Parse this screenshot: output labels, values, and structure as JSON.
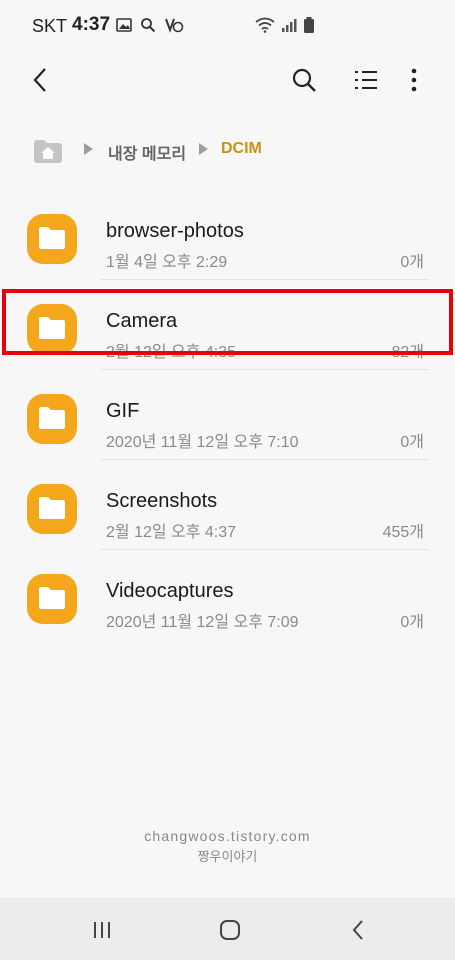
{
  "status_bar": {
    "carrier": "SKT",
    "time": "4:37"
  },
  "icons": {
    "back": "back-arrow-icon",
    "search": "search-icon",
    "list_view": "list-view-icon",
    "more": "more-vert-icon",
    "home": "home-icon",
    "folder": "folder-icon"
  },
  "breadcrumb": {
    "items": [
      "내장 메모리",
      "DCIM"
    ]
  },
  "folders": [
    {
      "name": "browser-photos",
      "date": "1월 4일 오후 2:29",
      "count": "0개"
    },
    {
      "name": "Camera",
      "date": "2월 12일 오후 4:35",
      "count": "82개"
    },
    {
      "name": "GIF",
      "date": "2020년 11월 12일 오후 7:10",
      "count": "0개"
    },
    {
      "name": "Screenshots",
      "date": "2월 12일 오후 4:37",
      "count": "455개"
    },
    {
      "name": "Videocaptures",
      "date": "2020년 11월 12일 오후 7:09",
      "count": "0개"
    }
  ],
  "watermark": {
    "line1": "changwoos.tistory.com",
    "line2": "짱우이야기"
  },
  "colors": {
    "folder": "#f4a71b",
    "highlight": "#e8000b",
    "breadcrumb_active": "#c89313"
  }
}
